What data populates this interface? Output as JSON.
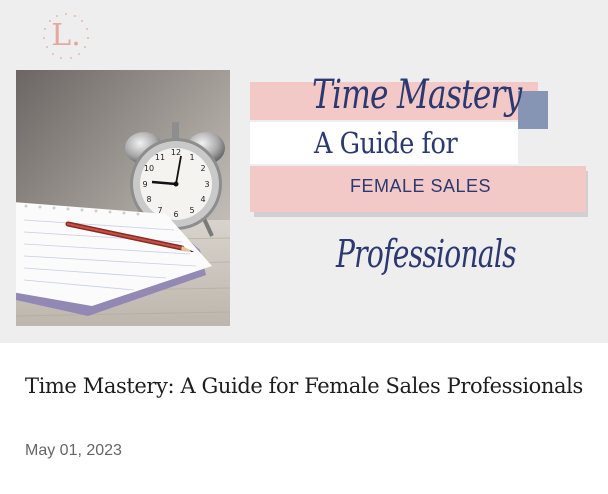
{
  "post": {
    "logo_letter": "L.",
    "banner": {
      "script_title": "Time Mastery",
      "guide_line": "A Guide for",
      "sales_line": "FEMALE SALES",
      "script_professionals": "Professionals"
    },
    "title": "Time Mastery: A Guide for Female Sales Professionals",
    "date": "May 01, 2023",
    "colors": {
      "pink_band": "#f3c9c7",
      "navy_text": "#2b3970",
      "accent_square": "#8795b5",
      "logo_peach": "#e2a99d"
    },
    "icons": [
      "alarm-clock-photo",
      "notepad",
      "pencil"
    ]
  }
}
